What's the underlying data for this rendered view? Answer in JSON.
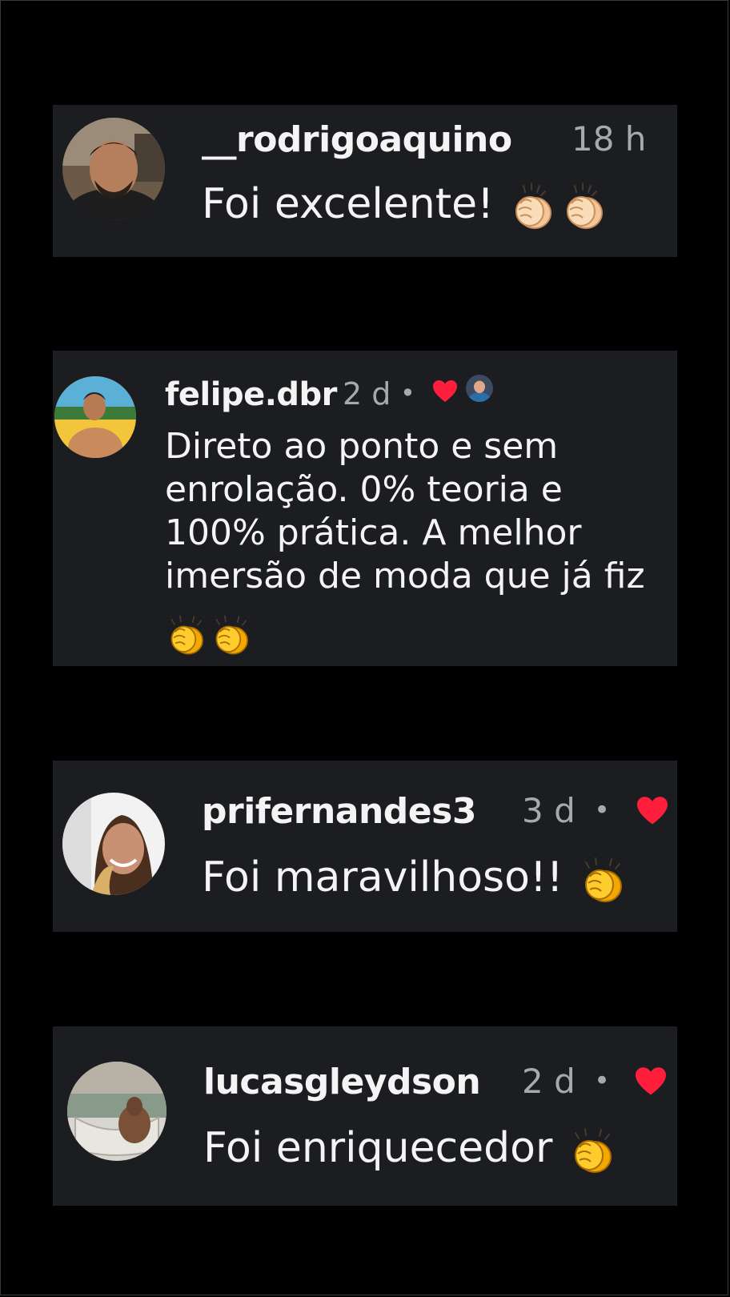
{
  "comments": [
    {
      "username": "__rodrigoaquino",
      "time": "18 h",
      "text": "Foi excelente!",
      "emoji": [
        "clapping-hands-icon",
        "clapping-hands-icon"
      ],
      "liked_by_creator": false
    },
    {
      "username": "felipe.dbr",
      "time": "2 d",
      "separator": "•",
      "text_lines": [
        "Direto ao ponto e sem",
        "enrolação. 0% teoria e",
        "100% prática. A melhor",
        "imersão de moda que já fiz"
      ],
      "emoji": [
        "clapping-hands-icon",
        "clapping-hands-icon"
      ],
      "liked_by_creator": true
    },
    {
      "username": "prifernandes3",
      "time": "3 d",
      "separator": "•",
      "text": "Foi maravilhoso!!",
      "emoji": [
        "clapping-hands-icon"
      ],
      "liked_by_creator": false,
      "liked": true
    },
    {
      "username": "lucasgleydson",
      "time": "2 d",
      "separator": "•",
      "text": "Foi enriquecedor",
      "emoji": [
        "clapping-hands-icon"
      ],
      "liked_by_creator": false,
      "liked": true
    }
  ],
  "colors": {
    "background": "#000000",
    "card": "#1b1d20",
    "text": "#f4f4f4",
    "muted": "#a6a9ad",
    "heart": "#ff1f3d",
    "clap_light": "#f7d3a8",
    "clap_yellow": "#ffc928"
  }
}
